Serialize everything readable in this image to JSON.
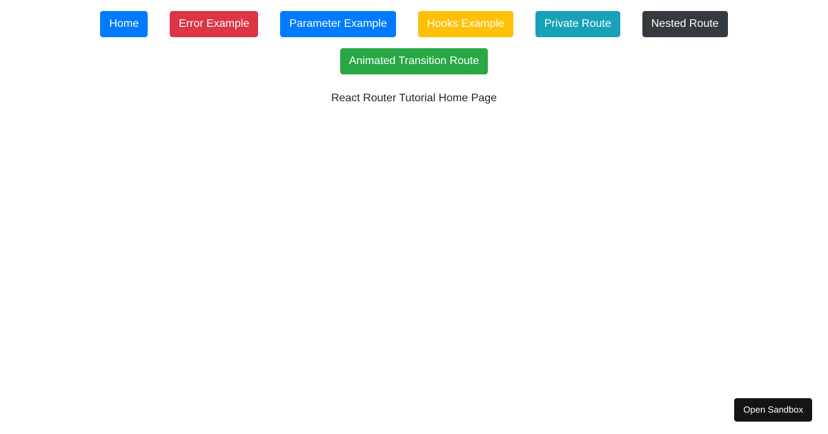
{
  "nav": {
    "row1": [
      {
        "label": "Home",
        "color": "#007bff"
      },
      {
        "label": "Error Example",
        "color": "#dc3545"
      },
      {
        "label": "Parameter Example",
        "color": "#007bff"
      },
      {
        "label": "Hooks Example",
        "color": "#ffc107"
      },
      {
        "label": "Private Route",
        "color": "#17a2b8"
      },
      {
        "label": "Nested Route",
        "color": "#343a40"
      }
    ],
    "row2": [
      {
        "label": "Animated Transition Route",
        "color": "#28a745"
      }
    ]
  },
  "main": {
    "text": "React Router Tutorial Home Page"
  },
  "sandbox": {
    "label": "Open Sandbox"
  }
}
